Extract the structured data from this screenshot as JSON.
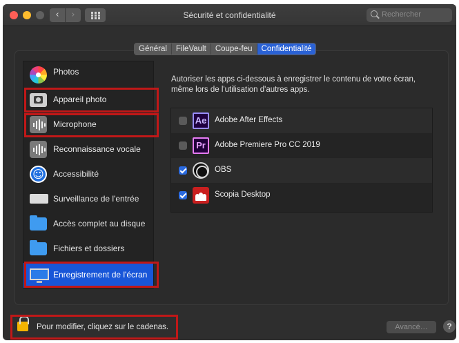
{
  "window": {
    "title": "Sécurité et confidentialité"
  },
  "search": {
    "placeholder": "Rechercher"
  },
  "tabs": [
    {
      "label": "Général",
      "active": false
    },
    {
      "label": "FileVault",
      "active": false
    },
    {
      "label": "Coupe-feu",
      "active": false
    },
    {
      "label": "Confidentialité",
      "active": true
    }
  ],
  "sidebar": {
    "items": [
      {
        "label": "Photos",
        "icon": "photos-icon"
      },
      {
        "label": "Appareil photo",
        "icon": "camera-icon",
        "highlighted": true
      },
      {
        "label": "Microphone",
        "icon": "microphone-icon",
        "highlighted": true
      },
      {
        "label": "Reconnaissance vocale",
        "icon": "speech-recognition-icon"
      },
      {
        "label": "Accessibilité",
        "icon": "accessibility-icon"
      },
      {
        "label": "Surveillance de l'entrée",
        "icon": "keyboard-icon"
      },
      {
        "label": "Accès complet au disque",
        "icon": "folder-icon"
      },
      {
        "label": "Fichiers et dossiers",
        "icon": "folder-icon"
      },
      {
        "label": "Enregistrement de l'écran",
        "icon": "screen-icon",
        "selected": true,
        "highlighted": true
      }
    ]
  },
  "main": {
    "description": "Autoriser les apps ci-dessous à enregistrer le contenu de votre écran, même lors de l'utilisation d'autres apps.",
    "apps": [
      {
        "name": "Adobe After Effects",
        "checked": false,
        "icon": "after-effects-icon",
        "icon_text": "Ae"
      },
      {
        "name": "Adobe Premiere Pro CC 2019",
        "checked": false,
        "icon": "premiere-pro-icon",
        "icon_text": "Pr"
      },
      {
        "name": "OBS",
        "checked": true,
        "icon": "obs-icon"
      },
      {
        "name": "Scopia Desktop",
        "checked": true,
        "icon": "scopia-icon"
      }
    ]
  },
  "footer": {
    "lock_text": "Pour modifier, cliquez sur le cadenas.",
    "advanced_label": "Avancé…",
    "help_label": "?"
  },
  "colors": {
    "highlight": "#c01818",
    "selection": "#1856d8",
    "tab_active": "#2a62d6"
  }
}
